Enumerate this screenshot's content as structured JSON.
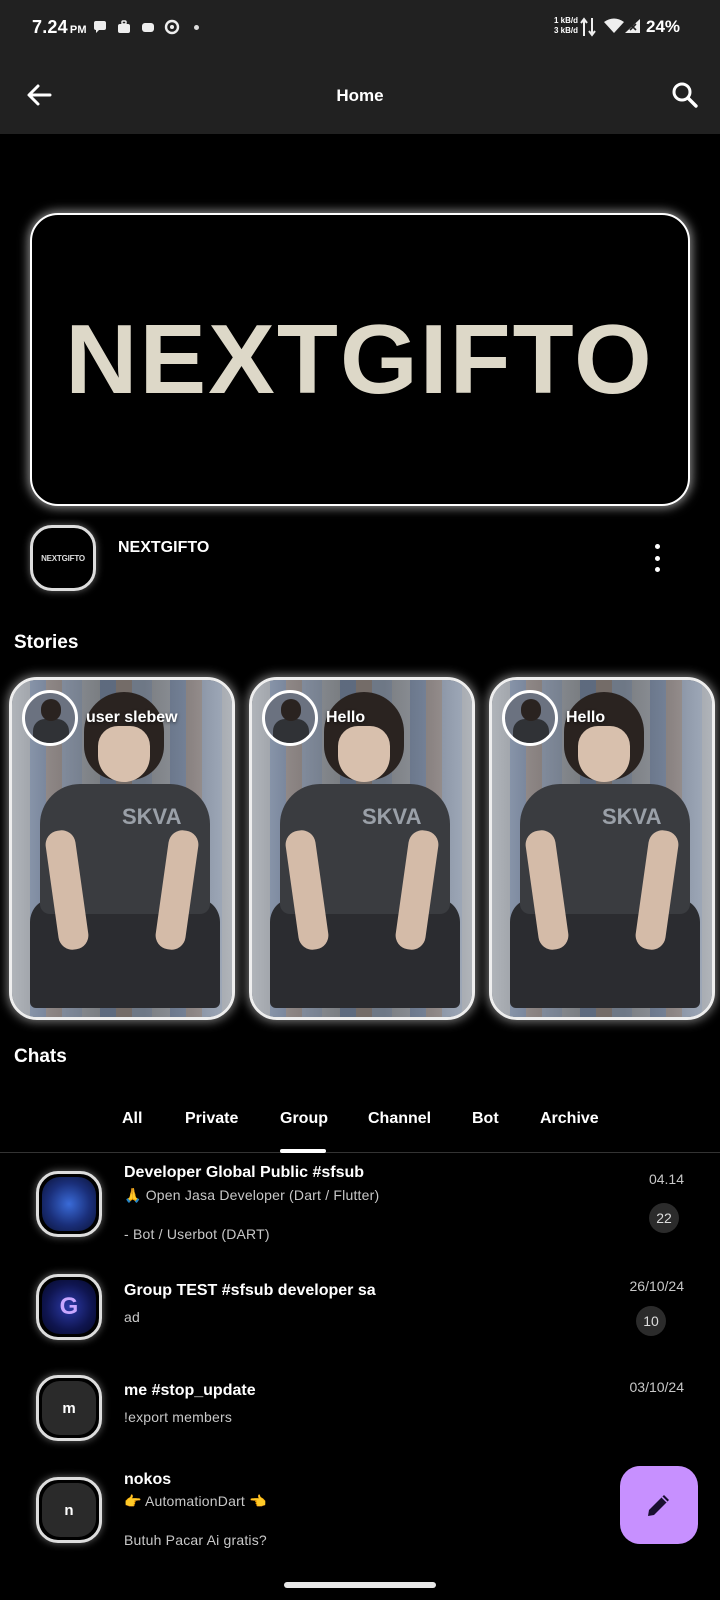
{
  "status_bar": {
    "time": "7.24",
    "ampm": "PM",
    "net_up": "1 kB/d",
    "net_down": "3 kB/d",
    "battery": "24%"
  },
  "app_bar": {
    "title": "Home"
  },
  "banner": {
    "logo_text": "NEXTGIFTO"
  },
  "profile": {
    "avatar_text": "NEXTGIFTO",
    "name": "NEXTGIFTO"
  },
  "stories": {
    "heading": "Stories",
    "items": [
      {
        "label": "user slebew"
      },
      {
        "label": "Hello"
      },
      {
        "label": "Hello"
      }
    ],
    "shirt_text": "SKVA"
  },
  "chats": {
    "heading": "Chats",
    "tabs": [
      {
        "label": "All"
      },
      {
        "label": "Private"
      },
      {
        "label": "Group",
        "active": true
      },
      {
        "label": "Channel"
      },
      {
        "label": "Bot"
      },
      {
        "label": "Archive"
      }
    ],
    "items": [
      {
        "avatar": "",
        "title": "Developer Global Public #sfsub",
        "line1": "🙏 Open Jasa Developer (Dart / Flutter)",
        "line2": "- Bot / Userbot (DART)",
        "date": "04.14",
        "badge": "22"
      },
      {
        "avatar": "G",
        "title": "Group TEST #sfsub developer sa",
        "line1": "ad",
        "line2": "",
        "date": "26/10/24",
        "badge": "10"
      },
      {
        "avatar": "m",
        "title": "me #stop_update",
        "line1": "!export members",
        "line2": "",
        "date": "03/10/24",
        "badge": ""
      },
      {
        "avatar": "n",
        "title": "nokos",
        "line1": "👉 AutomationDart 👈",
        "line2": "Butuh Pacar Ai gratis?",
        "date": "",
        "badge": ""
      }
    ]
  },
  "colors": {
    "background": "#000000",
    "bar": "#212121",
    "fab": "#c790ff",
    "badge": "#2b2b2b"
  },
  "icons": {
    "back": "arrow-left-icon",
    "search": "search-icon",
    "more": "more-vertical-icon",
    "fab": "pencil-icon"
  }
}
